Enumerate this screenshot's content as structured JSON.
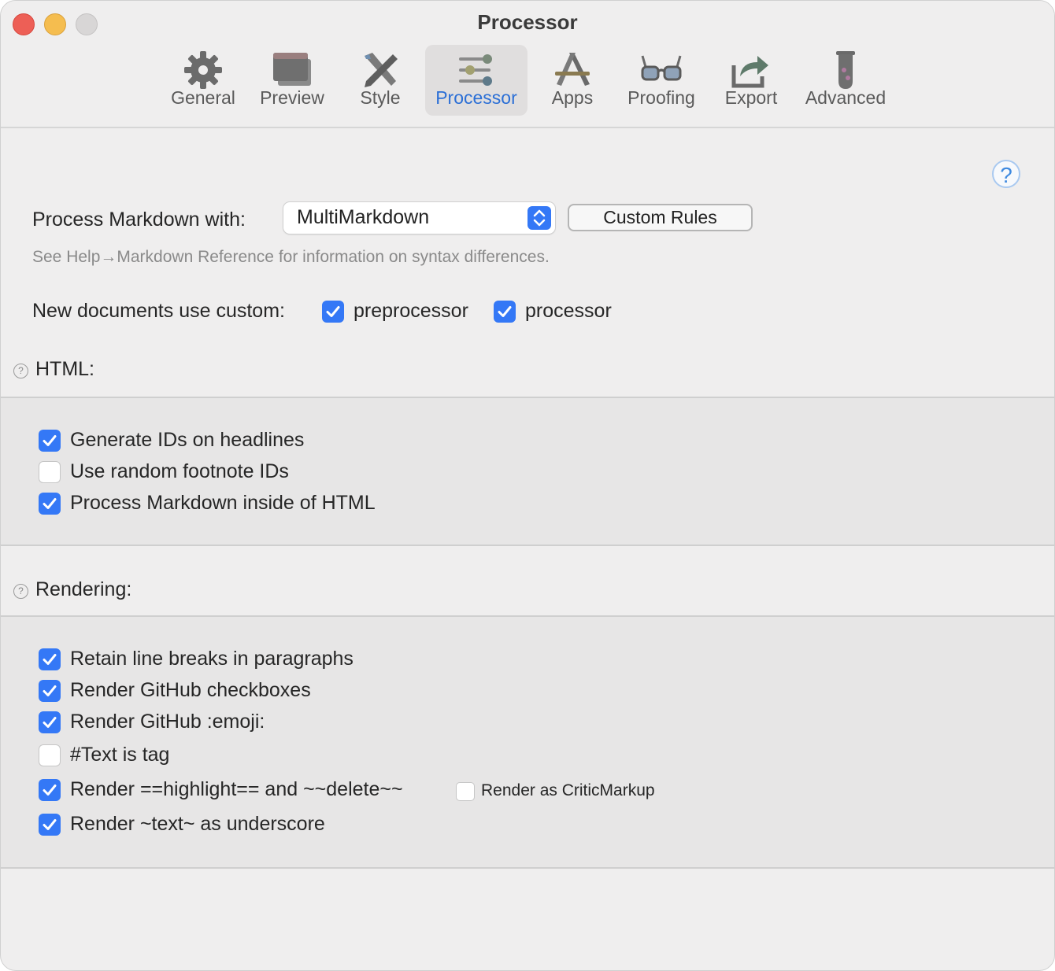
{
  "window": {
    "title": "Processor"
  },
  "toolbar": {
    "items": [
      {
        "label": "General",
        "icon": "gear-icon"
      },
      {
        "label": "Preview",
        "icon": "windows-icon"
      },
      {
        "label": "Style",
        "icon": "paintbrush-pencil-icon"
      },
      {
        "label": "Processor",
        "icon": "sliders-icon",
        "selected": true
      },
      {
        "label": "Apps",
        "icon": "app-store-icon"
      },
      {
        "label": "Proofing",
        "icon": "glasses-icon"
      },
      {
        "label": "Export",
        "icon": "share-arrow-icon"
      },
      {
        "label": "Advanced",
        "icon": "test-tube-icon"
      }
    ]
  },
  "help": {
    "glyph": "?"
  },
  "processor": {
    "label": "Process Markdown with:",
    "selected": "MultiMarkdown",
    "custom_rules_button": "Custom Rules",
    "hint": "See Help→Markdown Reference for information on syntax differences."
  },
  "new_docs": {
    "label": "New documents use custom:",
    "preprocessor": {
      "label": "preprocessor",
      "checked": true
    },
    "processor": {
      "label": "processor",
      "checked": true
    }
  },
  "html_section": {
    "title": "HTML:",
    "help_glyph": "?",
    "options": [
      {
        "label": "Generate IDs on headlines",
        "checked": true
      },
      {
        "label": "Use random footnote IDs",
        "checked": false
      },
      {
        "label": "Process Markdown inside of HTML",
        "checked": true
      }
    ]
  },
  "rendering_section": {
    "title": "Rendering:",
    "help_glyph": "?",
    "options": [
      {
        "label": "Retain line breaks in paragraphs",
        "checked": true
      },
      {
        "label": "Render GitHub checkboxes",
        "checked": true
      },
      {
        "label": "Render GitHub :emoji:",
        "checked": true
      },
      {
        "label": "#Text is tag",
        "checked": false
      },
      {
        "label": "Render ==highlight== and ~~delete~~",
        "checked": true
      },
      {
        "label": "Render ~text~ as underscore",
        "checked": true
      }
    ],
    "critic_markup": {
      "label": "Render as CriticMarkup",
      "checked": false
    }
  },
  "colors": {
    "accent": "#3478f6",
    "selected_tab_text": "#2b6fd6"
  }
}
